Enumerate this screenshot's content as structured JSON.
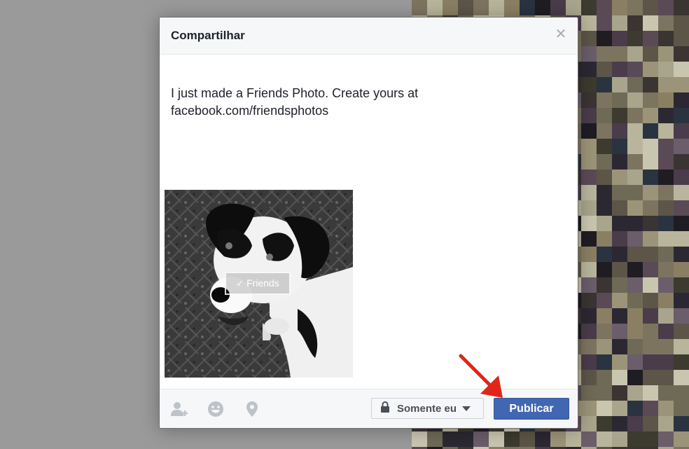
{
  "dialog": {
    "title": "Compartilhar",
    "close_icon": "close-icon"
  },
  "post": {
    "text_line1": "I just made a Friends Photo. Create yours at",
    "text_line2": "facebook.com/friendsphotos"
  },
  "photo": {
    "tag_label": "Friends",
    "tag_icon": "checkmark-icon"
  },
  "footer": {
    "tag_friends_icon": "add-friend-icon",
    "feeling_icon": "smiley-icon",
    "location_icon": "location-pin-icon",
    "privacy_label": "Somente eu",
    "privacy_icon": "lock-icon",
    "publish_label": "Publicar"
  },
  "annotation": {
    "arrow_icon": "red-arrow-icon",
    "arrow_color": "#e0261b"
  },
  "colors": {
    "publish_button": "#4267b2",
    "header_bg": "#f6f7f9",
    "overlay": "#9a9a9a"
  }
}
